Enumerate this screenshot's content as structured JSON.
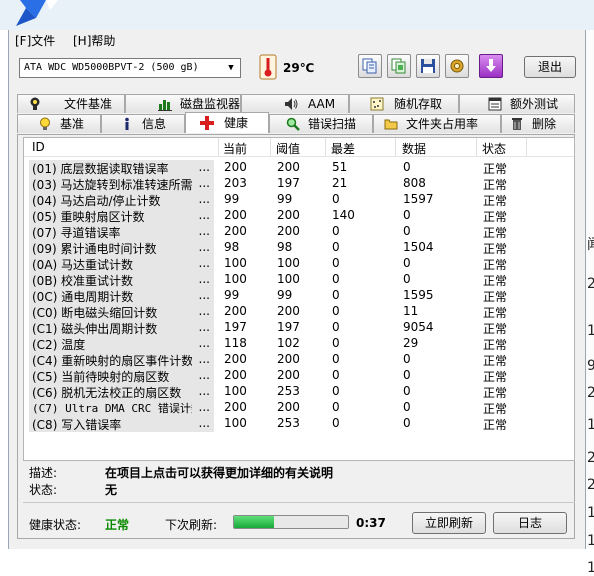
{
  "menu": {
    "file": "[F]文件",
    "help": "[H]帮助"
  },
  "toolbar": {
    "drive": "ATA   WDC WD5000BPVT-2 (500 gB)",
    "temperature": "29℃",
    "exit_label": "退出",
    "colors": {
      "download_button": "#b14ed3",
      "progress_fill": "#22b845",
      "health_ok": "#0a8a00"
    }
  },
  "tabs_row1": [
    {
      "label": "文件基准",
      "icon": "file-benchmark-icon"
    },
    {
      "label": "磁盘监视器",
      "icon": "disk-monitor-icon"
    },
    {
      "label": "AAM",
      "icon": "speaker-icon"
    },
    {
      "label": "随机存取",
      "icon": "random-access-icon"
    },
    {
      "label": "额外测试",
      "icon": "extra-tests-icon"
    }
  ],
  "tabs_row2": [
    {
      "label": "基准",
      "icon": "lightbulb-icon"
    },
    {
      "label": "信息",
      "icon": "info-icon"
    },
    {
      "label": "健康",
      "icon": "health-cross-icon"
    },
    {
      "label": "错误扫描",
      "icon": "magnifier-icon"
    },
    {
      "label": "文件夹占用率",
      "icon": "folder-icon"
    },
    {
      "label": "删除",
      "icon": "trash-icon"
    }
  ],
  "table": {
    "headers": [
      "ID",
      "当前",
      "阈值",
      "最差",
      "数据",
      "状态"
    ],
    "rows": [
      {
        "id": "(01) 底层数据读取错误率",
        "current": "200",
        "threshold": "200",
        "worst": "51",
        "data": "0",
        "status": "正常"
      },
      {
        "id": "(03) 马达旋转到标准转速所需",
        "current": "203",
        "threshold": "197",
        "worst": "21",
        "data": "808",
        "status": "正常"
      },
      {
        "id": "(04) 马达启动/停止计数",
        "current": "99",
        "threshold": "99",
        "worst": "0",
        "data": "1597",
        "status": "正常"
      },
      {
        "id": "(05) 重映射扇区计数",
        "current": "200",
        "threshold": "200",
        "worst": "140",
        "data": "0",
        "status": "正常"
      },
      {
        "id": "(07) 寻道错误率",
        "current": "200",
        "threshold": "200",
        "worst": "0",
        "data": "0",
        "status": "正常"
      },
      {
        "id": "(09) 累计通电时间计数",
        "current": "98",
        "threshold": "98",
        "worst": "0",
        "data": "1504",
        "status": "正常"
      },
      {
        "id": "(0A) 马达重试计数",
        "current": "100",
        "threshold": "100",
        "worst": "0",
        "data": "0",
        "status": "正常"
      },
      {
        "id": "(0B) 校准重试计数",
        "current": "100",
        "threshold": "100",
        "worst": "0",
        "data": "0",
        "status": "正常"
      },
      {
        "id": "(0C) 通电周期计数",
        "current": "99",
        "threshold": "99",
        "worst": "0",
        "data": "1595",
        "status": "正常"
      },
      {
        "id": "(C0) 断电磁头缩回计数",
        "current": "200",
        "threshold": "200",
        "worst": "0",
        "data": "11",
        "status": "正常"
      },
      {
        "id": "(C1) 磁头伸出周期计数",
        "current": "197",
        "threshold": "197",
        "worst": "0",
        "data": "9054",
        "status": "正常"
      },
      {
        "id": "(C2) 温度",
        "current": "118",
        "threshold": "102",
        "worst": "0",
        "data": "29",
        "status": "正常"
      },
      {
        "id": "(C4) 重新映射的扇区事件计数",
        "current": "200",
        "threshold": "200",
        "worst": "0",
        "data": "0",
        "status": "正常"
      },
      {
        "id": "(C5) 当前待映射的扇区数",
        "current": "200",
        "threshold": "200",
        "worst": "0",
        "data": "0",
        "status": "正常"
      },
      {
        "id": "(C6) 脱机无法校正的扇区数",
        "current": "100",
        "threshold": "253",
        "worst": "0",
        "data": "0",
        "status": "正常"
      },
      {
        "id": "(C7) Ultra DMA CRC 错误计数",
        "current": "200",
        "threshold": "200",
        "worst": "0",
        "data": "0",
        "status": "正常"
      },
      {
        "id": "(C8) 写入错误率",
        "current": "100",
        "threshold": "253",
        "worst": "0",
        "data": "0",
        "status": "正常"
      }
    ],
    "ellipsis": "..."
  },
  "description": {
    "label": "描述:",
    "text": "在项目上点击可以获得更加详细的有关说明",
    "state_label": "状态:",
    "state_value": "无"
  },
  "footer": {
    "health_label": "健康状态:",
    "health_value": "正常",
    "refresh_label": "下次刷新:",
    "progress_percent": 35,
    "timer": "0:37",
    "refresh_button": "立即刷新",
    "log_button": "日志"
  },
  "background_right_chars": [
    "闻",
    "2",
    "1",
    "9",
    "2",
    "1",
    "2",
    "2",
    "1",
    "1",
    "1",
    "2",
    "1",
    "2"
  ]
}
